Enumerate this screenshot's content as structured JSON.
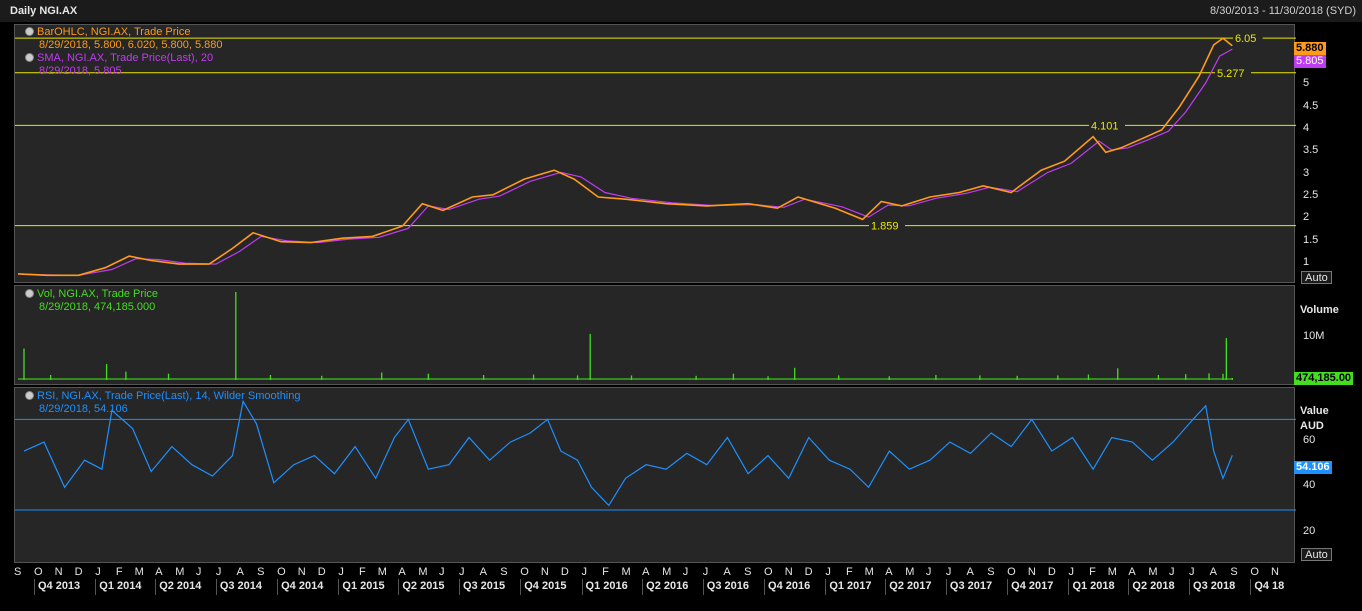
{
  "header": {
    "title": "Daily NGI.AX",
    "date_range": "8/30/2013 - 11/30/2018 (SYD)"
  },
  "colors": {
    "price": "#ff9a1a",
    "sma": "#c03cf0",
    "volume": "#44dd22",
    "rsi": "#1e90ff",
    "hline": "#e8e800"
  },
  "panels": {
    "price": {
      "legend1": "BarOHLC, NGI.AX, Trade Price",
      "legend1_values": "8/29/2018, 5.800, 6.020, 5.800, 5.880",
      "legend2": "SMA, NGI.AX, Trade Price(Last),  20",
      "legend2_values": "8/29/2018, 5.805",
      "last_price_badge": "5.880",
      "sma_badge": "5.805",
      "auto": "Auto"
    },
    "volume": {
      "legend": "Vol, NGI.AX, Trade Price",
      "legend_values": "8/29/2018, 474,185.000",
      "axis_title": "Volume",
      "badge": "474,185.00"
    },
    "rsi": {
      "legend": "RSI, NGI.AX, Trade Price(Last),  14, Wilder Smoothing",
      "legend_values": "8/29/2018, 54.106",
      "axis_title_1": "Value",
      "axis_title_2": "AUD",
      "badge": "54.106",
      "auto": "Auto"
    }
  },
  "x_axis": {
    "months": [
      "S",
      "O",
      "N",
      "D",
      "J",
      "F",
      "M",
      "A",
      "M",
      "J",
      "J",
      "A",
      "S",
      "O",
      "N",
      "D",
      "J",
      "F",
      "M",
      "A",
      "M",
      "J",
      "J",
      "A",
      "S",
      "O",
      "N",
      "D",
      "J",
      "F",
      "M",
      "A",
      "M",
      "J",
      "J",
      "A",
      "S",
      "O",
      "N",
      "D",
      "J",
      "F",
      "M",
      "A",
      "M",
      "J",
      "J",
      "A",
      "S",
      "O",
      "N",
      "D",
      "J",
      "F",
      "M",
      "A",
      "M",
      "J",
      "J",
      "A",
      "S",
      "O",
      "N"
    ],
    "quarters": [
      "Q4 2013",
      "Q1 2014",
      "Q2 2014",
      "Q3 2014",
      "Q4 2014",
      "Q1 2015",
      "Q2 2015",
      "Q3 2015",
      "Q4 2015",
      "Q1 2016",
      "Q2 2016",
      "Q3 2016",
      "Q4 2016",
      "Q1 2017",
      "Q2 2017",
      "Q3 2017",
      "Q4 2017",
      "Q1 2018",
      "Q2 2018",
      "Q3 2018",
      "Q4 18"
    ]
  },
  "chart_data": [
    {
      "type": "line",
      "title": "Daily NGI.AX",
      "x_range": [
        "8/30/2013",
        "11/30/2018"
      ],
      "ylim": [
        0.6,
        6.3
      ],
      "y_ticks": [
        "1",
        "1.5",
        "2",
        "2.5",
        "3",
        "3.5",
        "4",
        "4.5",
        "5"
      ],
      "y_tick_values": [
        1,
        1.5,
        2,
        2.5,
        3,
        3.5,
        4,
        4.5,
        5
      ],
      "horizontal_lines": [
        {
          "value": 6.05,
          "label": "6.05"
        },
        {
          "value": 5.277,
          "label": "5.277"
        },
        {
          "value": 4.101,
          "label": "4.101"
        },
        {
          "value": 1.859,
          "label": "1.859"
        }
      ],
      "series": [
        {
          "name": "BarOHLC, NGI.AX, Trade Price",
          "x": [
            "2013-09-01",
            "2013-10-15",
            "2013-12-01",
            "2014-01-10",
            "2014-02-15",
            "2014-03-20",
            "2014-05-01",
            "2014-06-15",
            "2014-07-20",
            "2014-08-20",
            "2014-10-01",
            "2014-11-15",
            "2015-01-01",
            "2015-02-15",
            "2015-04-01",
            "2015-05-01",
            "2015-06-01",
            "2015-07-15",
            "2015-08-15",
            "2015-10-01",
            "2015-11-15",
            "2015-12-15",
            "2016-01-20",
            "2016-03-01",
            "2016-05-01",
            "2016-07-01",
            "2016-09-01",
            "2016-10-15",
            "2016-11-15",
            "2017-01-10",
            "2017-02-20",
            "2017-03-20",
            "2017-04-20",
            "2017-06-01",
            "2017-07-15",
            "2017-08-20",
            "2017-10-01",
            "2017-11-15",
            "2017-12-20",
            "2018-02-01",
            "2018-02-20",
            "2018-03-15",
            "2018-04-15",
            "2018-05-15",
            "2018-06-10",
            "2018-07-10",
            "2018-08-01",
            "2018-08-15",
            "2018-08-29"
          ],
          "values": [
            0.78,
            0.75,
            0.75,
            0.92,
            1.18,
            1.08,
            1.0,
            1.0,
            1.35,
            1.7,
            1.5,
            1.48,
            1.58,
            1.62,
            1.85,
            2.35,
            2.2,
            2.5,
            2.55,
            2.9,
            3.1,
            2.9,
            2.5,
            2.45,
            2.35,
            2.3,
            2.35,
            2.25,
            2.5,
            2.25,
            2.0,
            2.4,
            2.3,
            2.5,
            2.6,
            2.75,
            2.6,
            3.1,
            3.3,
            3.85,
            3.5,
            3.6,
            3.8,
            4.0,
            4.5,
            5.2,
            5.9,
            6.05,
            5.88
          ]
        },
        {
          "name": "SMA, NGI.AX, Trade Price(Last),  20",
          "x": [
            "2013-09-01",
            "2013-10-15",
            "2013-12-01",
            "2014-01-20",
            "2014-02-25",
            "2014-04-01",
            "2014-05-10",
            "2014-06-25",
            "2014-07-30",
            "2014-09-01",
            "2014-10-10",
            "2014-11-25",
            "2015-01-10",
            "2015-02-25",
            "2015-04-10",
            "2015-05-10",
            "2015-06-10",
            "2015-07-25",
            "2015-08-25",
            "2015-10-10",
            "2015-11-25",
            "2015-12-25",
            "2016-01-30",
            "2016-03-10",
            "2016-05-10",
            "2016-07-10",
            "2016-09-10",
            "2016-10-25",
            "2016-11-25",
            "2017-01-20",
            "2017-03-01",
            "2017-03-30",
            "2017-04-30",
            "2017-06-10",
            "2017-07-25",
            "2017-08-30",
            "2017-10-10",
            "2017-11-25",
            "2017-12-30",
            "2018-02-10",
            "2018-03-01",
            "2018-03-25",
            "2018-04-25",
            "2018-05-25",
            "2018-06-20",
            "2018-07-20",
            "2018-08-10",
            "2018-08-29"
          ],
          "values": [
            0.78,
            0.76,
            0.75,
            0.88,
            1.12,
            1.1,
            1.02,
            1.0,
            1.28,
            1.62,
            1.52,
            1.48,
            1.56,
            1.6,
            1.8,
            2.3,
            2.22,
            2.45,
            2.52,
            2.85,
            3.05,
            2.95,
            2.6,
            2.47,
            2.37,
            2.31,
            2.33,
            2.27,
            2.45,
            2.28,
            2.05,
            2.32,
            2.3,
            2.47,
            2.58,
            2.72,
            2.62,
            3.05,
            3.25,
            3.75,
            3.55,
            3.6,
            3.78,
            3.97,
            4.4,
            5.05,
            5.65,
            5.805
          ]
        }
      ]
    },
    {
      "type": "bar",
      "title": "Vol, NGI.AX, Trade Price",
      "y_ticks": [
        "10M"
      ],
      "y_tick_values": [
        10000000
      ],
      "ylim": [
        0,
        21000000
      ],
      "series": [
        {
          "name": "Vol, NGI.AX, Trade Price",
          "x": [
            "2013-09-10",
            "2013-10-20",
            "2014-01-12",
            "2014-02-10",
            "2014-04-15",
            "2014-07-25",
            "2014-09-15",
            "2014-12-01",
            "2015-03-01",
            "2015-05-10",
            "2015-08-01",
            "2015-10-15",
            "2015-12-20",
            "2016-01-08",
            "2016-03-10",
            "2016-06-15",
            "2016-08-10",
            "2016-10-01",
            "2016-11-10",
            "2017-01-15",
            "2017-04-01",
            "2017-06-10",
            "2017-08-15",
            "2017-10-10",
            "2017-12-10",
            "2018-01-25",
            "2018-03-10",
            "2018-05-10",
            "2018-06-20",
            "2018-07-25",
            "2018-08-15",
            "2018-08-20",
            "2018-08-29"
          ],
          "values": [
            7500000,
            1200000,
            3800000,
            2000000,
            1500000,
            21000000,
            1200000,
            1000000,
            1800000,
            1500000,
            1200000,
            1300000,
            1100000,
            11000000,
            1100000,
            1000000,
            1500000,
            900000,
            2900000,
            1100000,
            900000,
            1200000,
            1100000,
            1000000,
            1100000,
            1300000,
            2800000,
            1200000,
            1400000,
            1600000,
            1500000,
            10000000,
            474185
          ]
        }
      ]
    },
    {
      "type": "line",
      "title": "RSI, NGI.AX, Trade Price(Last),  14, Wilder Smoothing",
      "ylim": [
        7,
        83
      ],
      "y_ticks": [
        "20",
        "40",
        "60"
      ],
      "y_tick_values": [
        20,
        40,
        60
      ],
      "horizontal_lines": [
        {
          "value": 70
        },
        {
          "value": 30
        }
      ],
      "series": [
        {
          "name": "RSI, NGI.AX, Trade Price(Last),  14, Wilder Smoothing",
          "x": [
            "2013-09-10",
            "2013-10-10",
            "2013-11-10",
            "2013-12-10",
            "2014-01-05",
            "2014-01-20",
            "2014-02-20",
            "2014-03-20",
            "2014-04-20",
            "2014-05-20",
            "2014-06-20",
            "2014-07-20",
            "2014-08-05",
            "2014-08-25",
            "2014-09-20",
            "2014-10-20",
            "2014-11-20",
            "2014-12-20",
            "2015-01-20",
            "2015-02-20",
            "2015-03-20",
            "2015-04-10",
            "2015-05-10",
            "2015-06-10",
            "2015-07-10",
            "2015-08-10",
            "2015-09-10",
            "2015-10-10",
            "2015-11-05",
            "2015-11-25",
            "2015-12-20",
            "2016-01-10",
            "2016-02-05",
            "2016-03-01",
            "2016-04-01",
            "2016-05-01",
            "2016-06-01",
            "2016-07-01",
            "2016-08-01",
            "2016-09-01",
            "2016-10-01",
            "2016-11-01",
            "2016-12-01",
            "2017-01-01",
            "2017-02-01",
            "2017-03-01",
            "2017-04-01",
            "2017-05-01",
            "2017-06-01",
            "2017-07-01",
            "2017-08-01",
            "2017-09-01",
            "2017-10-01",
            "2017-11-01",
            "2017-12-01",
            "2018-01-01",
            "2018-02-01",
            "2018-03-01",
            "2018-04-01",
            "2018-05-01",
            "2018-06-01",
            "2018-07-01",
            "2018-07-20",
            "2018-08-01",
            "2018-08-15",
            "2018-08-29"
          ],
          "values": [
            56,
            60,
            40,
            52,
            48,
            74,
            66,
            47,
            58,
            50,
            45,
            54,
            78,
            68,
            42,
            50,
            54,
            46,
            58,
            44,
            62,
            70,
            48,
            50,
            62,
            52,
            60,
            64,
            70,
            56,
            52,
            40,
            32,
            44,
            50,
            48,
            55,
            50,
            62,
            46,
            54,
            44,
            62,
            52,
            48,
            40,
            56,
            48,
            52,
            60,
            55,
            64,
            58,
            70,
            56,
            62,
            48,
            62,
            60,
            52,
            60,
            70,
            76,
            56,
            44,
            54.106
          ]
        }
      ]
    }
  ]
}
